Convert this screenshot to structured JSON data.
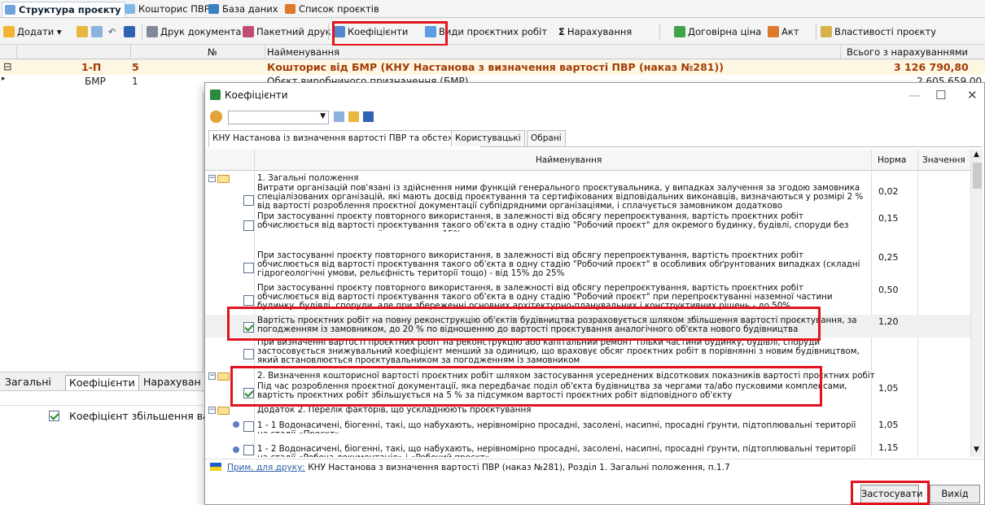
{
  "app_tabs": [
    {
      "label": "Структура проєкту"
    },
    {
      "label": "Кошторис ПВР"
    },
    {
      "label": "База даних"
    },
    {
      "label": "Список проєктів"
    }
  ],
  "toolbar": {
    "add": "Додати",
    "print_doc": "Друк документа",
    "batch_print": "Пакетний друк",
    "coefficients": "Коефіцієнти",
    "work_types": "Види проєктних робіт",
    "sigma": "Σ",
    "charges": "Нарахування",
    "contract_price": "Договірна ціна",
    "act": "Акт",
    "properties": "Властивості проєкту"
  },
  "grid": {
    "headers": {
      "no": "№",
      "name": "Найменування",
      "total": "Всього з нарахуваннями"
    },
    "rows": [
      {
        "code": "1-П",
        "num": "5",
        "name": "Кошторис від БМР (КНУ Настанова з визначення вартості ПВР (наказ №281))",
        "total": "3 126 790,80"
      },
      {
        "code": "БМР",
        "num": "1",
        "name": "Обєкт виробничого призначення (БМР)",
        "total": "2 605 659,00"
      }
    ]
  },
  "bottom_tabs": [
    "Загальні",
    "Коефіцієнти",
    "Нарахуван"
  ],
  "left_list": {
    "item": "Коефіцієнт збільшення вар"
  },
  "dialog": {
    "title": "Коефіцієнти",
    "tabs": [
      "КНУ Настанова із визначення вартості ПВР та обстеження",
      "Користувацькі",
      "Обрані"
    ],
    "col_name": "Найменування",
    "col_norm": "Норма",
    "col_value": "Значення",
    "rows": [
      {
        "kind": "group",
        "text": "1. Загальні положення"
      },
      {
        "kind": "item",
        "checked": false,
        "norm": "0,02",
        "text": "Витрати організацій пов'язані із здійснення ними функцій генерального проєктувальника, у випадках залучення за згодою замовника спеціалізованих організацій, які мають досвід проєктування та сертифікованих відповідальних виконавців, визначаються у розмірі 2 % від вартості розроблення проєктної документації субпідрядними організаціями, і сплачується замовником додатково"
      },
      {
        "kind": "item",
        "checked": false,
        "norm": "0,15",
        "text": "При застосуванні проєкту повторного використання, в залежності від обсягу перепроєктування, вартість проєктних робіт обчислюється від вартості проєктування такого об'єкта в одну стадію \"Робочий проєкт\" для окремого будинку, будівлі, споруди без перепроєктування наземної частини - до 15%."
      },
      {
        "kind": "item",
        "checked": false,
        "norm": "0,25",
        "text": "При застосуванні проєкту повторного використання, в залежності від обсягу перепроєктування, вартість проєктних робіт обчислюється від вартості проєктування такого об'єкта в одну стадію \"Робочий проєкт\" в особливих обґрунтованих випадках (складні гідрогеологічні умови, рельєфність території тощо) - від 15% до 25%"
      },
      {
        "kind": "item",
        "checked": false,
        "norm": "0,50",
        "text": "При застосуванні проєкту повторного використання, в залежності від обсягу перепроєктування, вартість проєктних робіт обчислюється від вартості проєктування такого об'єкта в одну стадію \"Робочий проєкт\" при перепроєктуванні наземної частини будинку, будівлі, споруди, але при збереженні основних архітектурно-планувальних і конструктивних рішень - до 50%"
      },
      {
        "kind": "item",
        "checked": true,
        "selected": true,
        "norm": "1,20",
        "text": "Вартість проєктних робіт на повну реконструкцію об'єктів будівництва розраховується шляхом збільшення вартості проєктування, за погодженням із замовником, до 20 % по відношенню до вартості проєктування аналогічного об'єкта нового будівництва"
      },
      {
        "kind": "item",
        "checked": false,
        "norm": "",
        "text": "При визначенні вартості проєктних робіт на реконструкцію або капітальний ремонт тільки частини будинку, будівлі, споруди застосовується знижувальний коефіцієнт менший за одиницю, що враховує обсяг проєктних робіт в порівнянні з новим будівництвом, який встановлюється проєктувальником за погодженням із замовником"
      },
      {
        "kind": "group",
        "text": "2. Визначення кошторисної вартості проєктних робіт шляхом застосування усереднених відсоткових показників вартості проєктних робіт"
      },
      {
        "kind": "item",
        "checked": true,
        "norm": "1,05",
        "text": "Під час розроблення проєктної документації, яка передбачає поділ об'єкта будівництва за чергами та/або пусковими комплексами, вартість проєктних робіт збільшується на 5 % за підсумком вартості проєктних робіт відповідного об'єкту"
      },
      {
        "kind": "group",
        "text": "Додаток 2. Перелік факторів, що ускладнюють проєктування"
      },
      {
        "kind": "item",
        "checked": false,
        "star": true,
        "norm": "1,05",
        "text": "1 - 1 Водонасичені, біогенні, такі, що набухають, нерівномірно просадні, засолені, насипні, просадні ґрунти, підтоплювальні території на стадії «Проєкт»"
      },
      {
        "kind": "item",
        "checked": false,
        "star": true,
        "norm": "1,15",
        "text": "1 - 2 Водонасичені, біогенні, такі, що набухають, нерівномірно просадні, засолені, насипні, просадні ґрунти, підтоплювальні території на стадії «Робоча документація» і «Робочий проєкт»"
      }
    ],
    "note_label": "Прим. для друку:",
    "note_text": "КНУ Настанова з визначення вартості ПВР (наказ №281), Розділ 1. Загальні положення, п.1.7",
    "apply": "Застосувати",
    "exit": "Вихід"
  }
}
